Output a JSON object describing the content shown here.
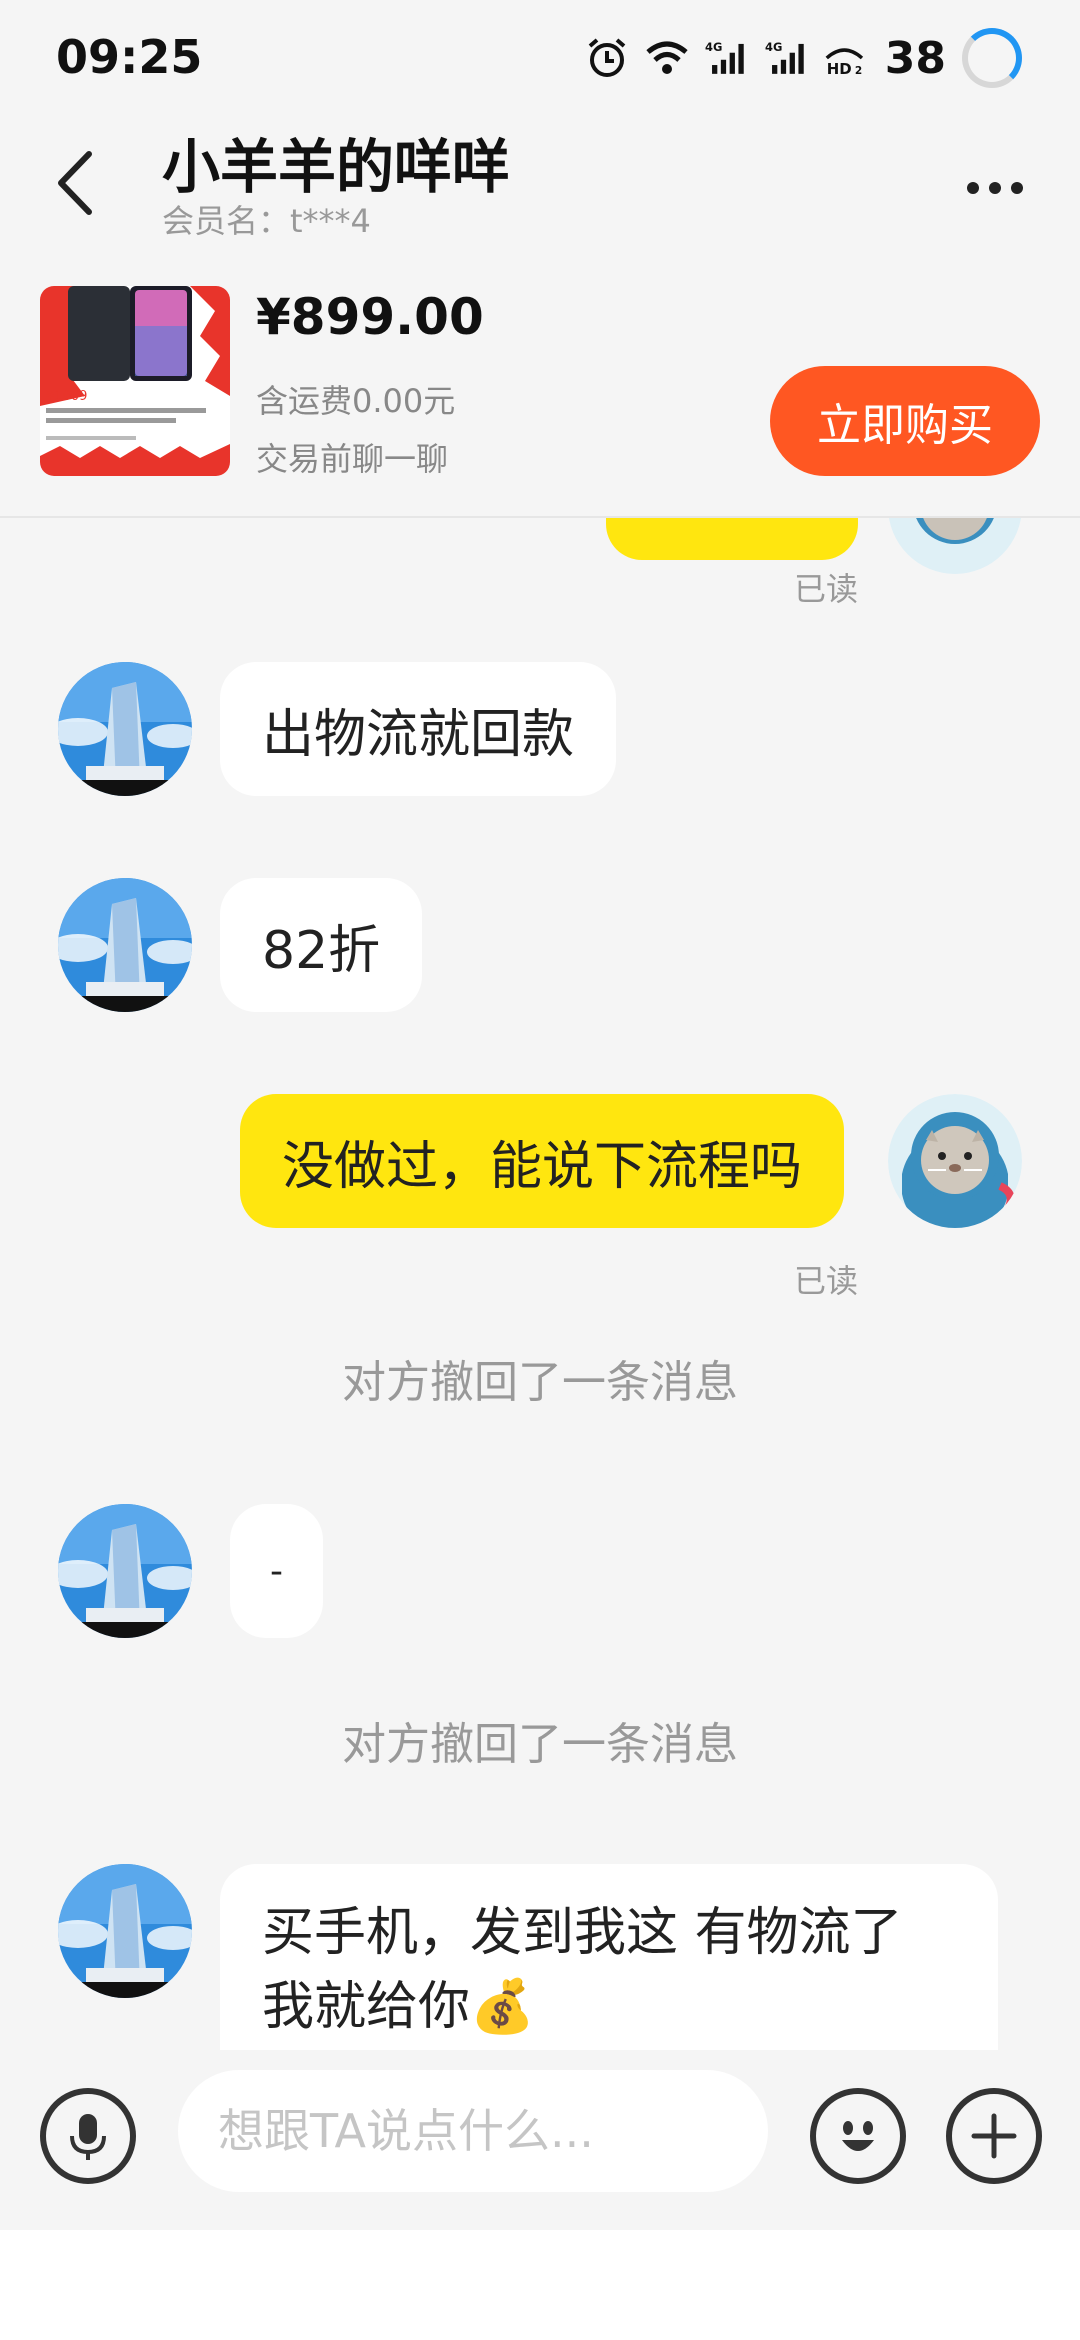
{
  "status_bar": {
    "time": "09:25",
    "battery": "38",
    "icons": [
      "alarm-icon",
      "wifi-icon",
      "signal-4g-icon",
      "signal-4g-icon",
      "hd-icon"
    ]
  },
  "header": {
    "contact_name": "小羊羊的咩咩",
    "member_label": "会员名：t***4"
  },
  "product": {
    "price": "¥899.00",
    "shipping": "含运费0.00元",
    "chat_before": "交易前聊一聊",
    "buy_label": "立即购买"
  },
  "messages": {
    "read_1": "已读",
    "msg_logistics": "出物流就回款",
    "msg_discount": "82折",
    "msg_ask": "没做过，能说下流程吗",
    "read_2": "已读",
    "recalled_1": "对方撤回了一条消息",
    "msg_dash": "-",
    "recalled_2": "对方撤回了一条消息",
    "msg_buy_line1": "买手机，发到我这 有物流了",
    "msg_buy_line2": "我就给你💰"
  },
  "input": {
    "placeholder": "想跟TA说点什么..."
  },
  "colors": {
    "accent_yellow": "#ffe60f",
    "buy_orange": "#ff5722",
    "background": "#f5f5f5"
  }
}
